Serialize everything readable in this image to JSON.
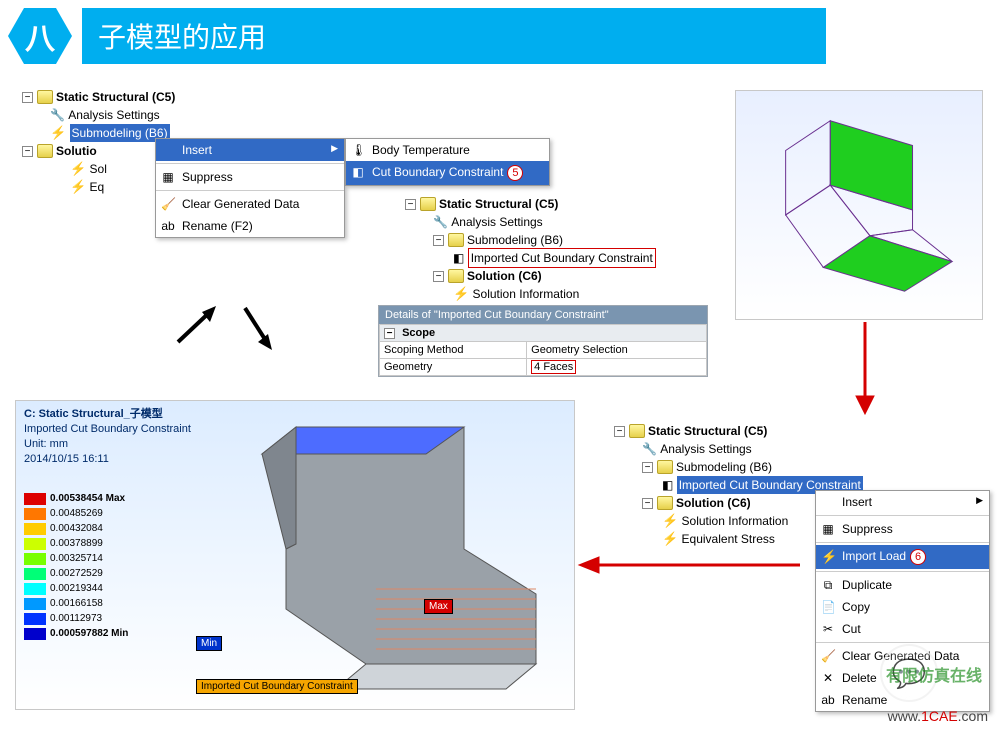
{
  "header": {
    "hex": "八",
    "title": "子模型的应用"
  },
  "tree1": {
    "n0": "Static Structural (C5)",
    "n1": "Analysis Settings",
    "n2": "Submodeling (B6)",
    "n3": "Solutio",
    "n4": "Sol",
    "n5": "Eq"
  },
  "menu1": {
    "insert": "Insert",
    "suppress": "Suppress",
    "clear": "Clear Generated Data",
    "rename": "Rename (F2)"
  },
  "submenu1": {
    "temp": "Body Temperature",
    "cut": "Cut Boundary Constraint",
    "num": "5"
  },
  "tree2": {
    "n0": "Static Structural (C5)",
    "n1": "Analysis Settings",
    "n2": "Submodeling (B6)",
    "n3": "Imported Cut Boundary Constraint",
    "n4": "Solution (C6)",
    "n5": "Solution Information"
  },
  "details": {
    "hd": "Details of \"Imported Cut Boundary Constraint\"",
    "scope": "Scope",
    "sm": "Scoping Method",
    "smv": "Geometry Selection",
    "g": "Geometry",
    "gv": "4 Faces"
  },
  "tree3": {
    "n0": "Static Structural (C5)",
    "n1": "Analysis Settings",
    "n2": "Submodeling (B6)",
    "n3": "Imported Cut Boundary Constraint",
    "n4": "Solution (C6)",
    "n5": "Solution Information",
    "n6": "Equivalent Stress"
  },
  "menu2": {
    "insert": "Insert",
    "suppress": "Suppress",
    "import": "Import Load",
    "num": "6",
    "dup": "Duplicate",
    "copy": "Copy",
    "cut": "Cut",
    "clear": "Clear Generated Data",
    "del": "Delete",
    "ren": "Rename"
  },
  "result": {
    "title": "C: Static Structural_子模型",
    "sub": "Imported Cut Boundary Constraint",
    "unit": "Unit: mm",
    "ts": "2014/10/15 16:11",
    "legend": [
      {
        "c": "#dd0000",
        "v": "0.00538454 Max"
      },
      {
        "c": "#ff7700",
        "v": "0.00485269"
      },
      {
        "c": "#ffcc00",
        "v": "0.00432084"
      },
      {
        "c": "#ccff00",
        "v": "0.00378899"
      },
      {
        "c": "#77ff00",
        "v": "0.00325714"
      },
      {
        "c": "#00ff77",
        "v": "0.00272529"
      },
      {
        "c": "#00ffff",
        "v": "0.00219344"
      },
      {
        "c": "#0099ff",
        "v": "0.00166158"
      },
      {
        "c": "#0033ff",
        "v": "0.00112973"
      },
      {
        "c": "#0000cc",
        "v": "0.000597882 Min"
      }
    ],
    "min": "Min",
    "max": "Max",
    "imp": "Imported Cut Boundary Constraint"
  },
  "wm": {
    "pre": "www.",
    "mid": "1CAE",
    "suf": ".com",
    "txt": "有限仿真在线"
  }
}
